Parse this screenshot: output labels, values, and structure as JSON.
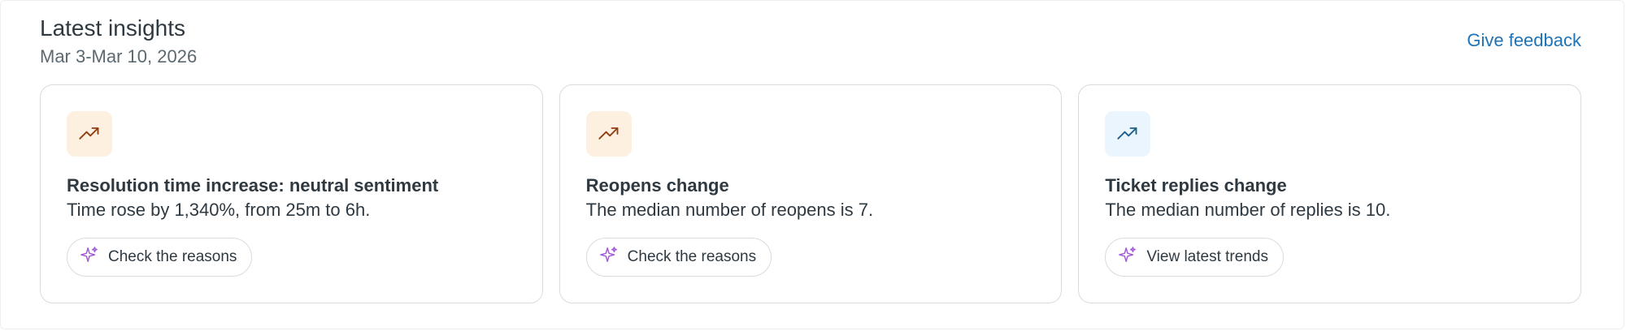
{
  "header": {
    "title": "Latest insights",
    "date_range": "Mar 3-Mar 10, 2026",
    "feedback_link": "Give feedback"
  },
  "colors": {
    "link": "#1f73b7",
    "warm_icon_bg": "#fef0e1",
    "warm_icon_stroke": "#8f3e12",
    "cool_icon_bg": "#eaf5fd",
    "cool_icon_stroke": "#1f5f8b",
    "sparkle": "#a35bd9"
  },
  "cards": [
    {
      "icon": "trending-up-icon",
      "title": "Resolution time increase: neutral sentiment",
      "body": "Time rose by 1,340%, from 25m to 6h.",
      "button_icon": "sparkle-icon",
      "button_label": "Check the reasons"
    },
    {
      "icon": "trending-up-icon",
      "title": "Reopens change",
      "body": "The median number of reopens is 7.",
      "button_icon": "sparkle-icon",
      "button_label": "Check the reasons"
    },
    {
      "icon": "trending-up-icon",
      "title": "Ticket replies change",
      "body": "The median number of replies is 10.",
      "button_icon": "sparkle-icon",
      "button_label": "View latest trends"
    }
  ]
}
